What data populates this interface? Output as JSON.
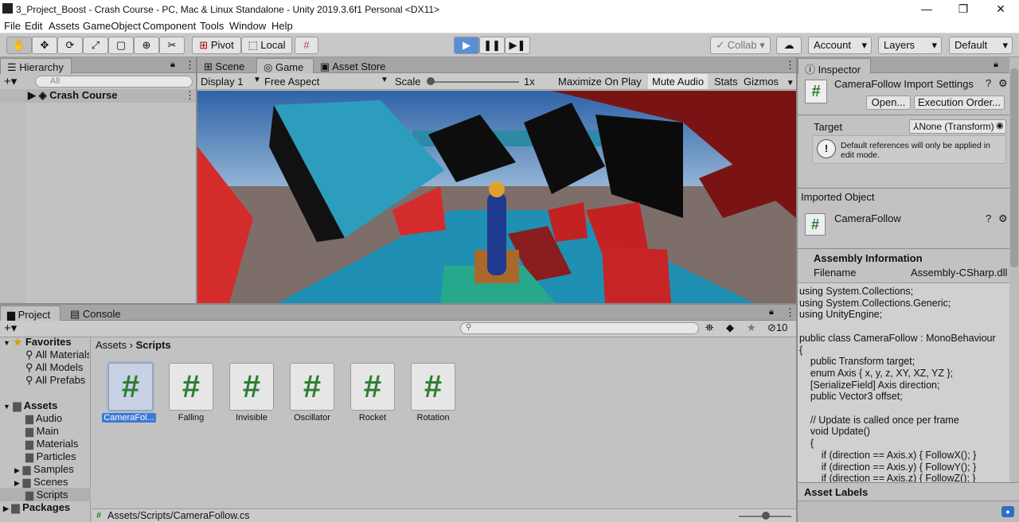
{
  "window": {
    "title": "3_Project_Boost - Crash Course - PC, Mac & Linux Standalone - Unity 2019.3.6f1 Personal <DX11>",
    "min": "—",
    "max": "❐",
    "close": "✕"
  },
  "menu": [
    "File",
    "Edit",
    "Assets",
    "GameObject",
    "Component",
    "Tools",
    "Window",
    "Help"
  ],
  "toolbar": {
    "pivot": "Pivot",
    "local": "Local",
    "collab": "Collab",
    "account": "Account",
    "layers": "Layers",
    "layout": "Default"
  },
  "hierarchy": {
    "tab": "Hierarchy",
    "search_placeholder": "All",
    "scene": "Crash Course"
  },
  "game": {
    "tabs": [
      "Scene",
      "Game",
      "Asset Store"
    ],
    "display": "Display 1",
    "aspect": "Free Aspect",
    "scale_label": "Scale",
    "scale_value": "1x",
    "buttons": [
      "Maximize On Play",
      "Mute Audio",
      "Stats",
      "Gizmos"
    ]
  },
  "inspector": {
    "tab": "Inspector",
    "header": "CameraFollow Import Settings",
    "open": "Open...",
    "exec": "Execution Order...",
    "target_label": "Target",
    "target_value": "None (Transform)",
    "note": "Default references will only be applied in edit mode.",
    "imported_label": "Imported Object",
    "imported_name": "CameraFollow",
    "assembly_title": "Assembly Information",
    "filename_label": "Filename",
    "filename_value": "Assembly-CSharp.dll",
    "code": "using System.Collections;\nusing System.Collections.Generic;\nusing UnityEngine;\n\npublic class CameraFollow : MonoBehaviour\n{\n    public Transform target;\n    enum Axis { x, y, z, XY, XZ, YZ };\n    [SerializeField] Axis direction;\n    public Vector3 offset;\n\n    // Update is called once per frame\n    void Update()\n    {\n        if (direction == Axis.x) { FollowX(); }\n        if (direction == Axis.y) { FollowY(); }\n        if (direction == Axis.z) { FollowZ(); }",
    "asset_labels": "Asset Labels"
  },
  "project": {
    "tabs": [
      "Project",
      "Console"
    ],
    "hidden_count": "10",
    "favorites": "Favorites",
    "fav_items": [
      "All Materials",
      "All Models",
      "All Prefabs"
    ],
    "assets": "Assets",
    "asset_folders": [
      "Audio",
      "Main",
      "Materials",
      "Particles",
      "Samples",
      "Scenes",
      "Scripts"
    ],
    "packages": "Packages",
    "breadcrumb": [
      "Assets",
      "Scripts"
    ],
    "scripts": [
      "CameraFol...",
      "Falling",
      "Invisible",
      "Oscillator",
      "Rocket",
      "Rotation"
    ],
    "status_path": "Assets/Scripts/CameraFollow.cs"
  }
}
